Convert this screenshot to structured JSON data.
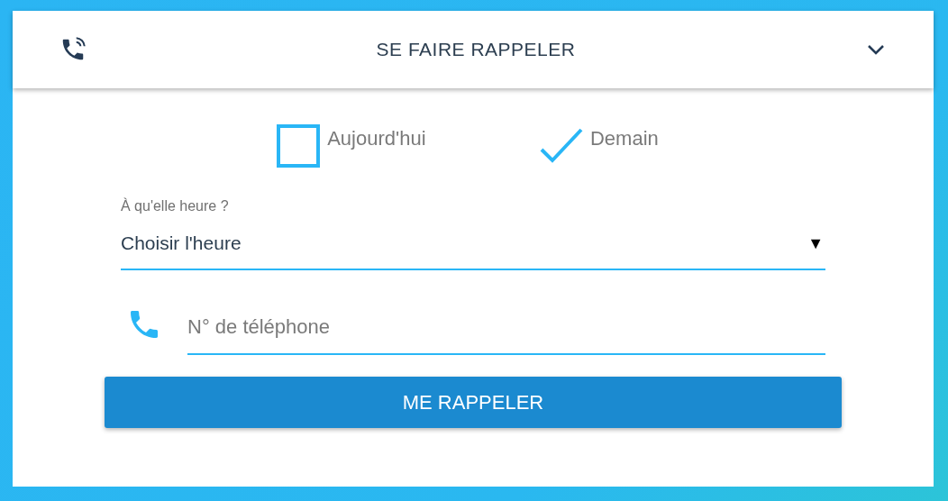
{
  "header": {
    "title": "SE FAIRE RAPPELER",
    "expanded": true
  },
  "days": [
    {
      "label": "Aujourd'hui",
      "checked": false
    },
    {
      "label": "Demain",
      "checked": true
    }
  ],
  "time_select": {
    "label": "À qu'elle heure ?",
    "value": "Choisir l'heure",
    "arrow": "▼"
  },
  "phone": {
    "placeholder": "N° de téléphone"
  },
  "submit": {
    "label": "ME RAPPELER"
  }
}
